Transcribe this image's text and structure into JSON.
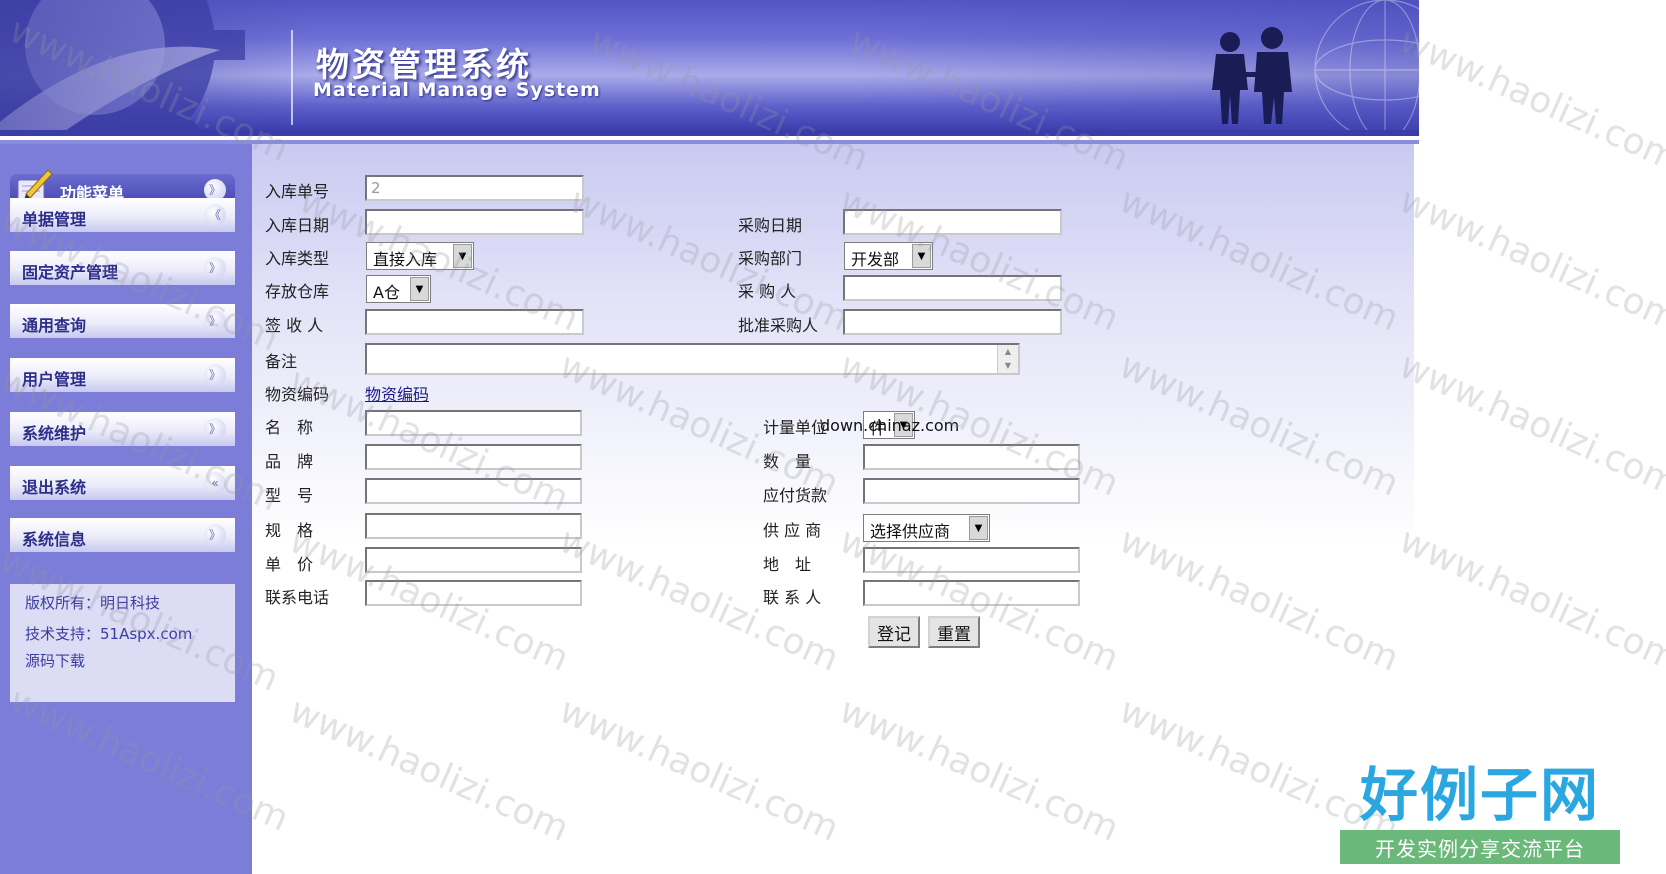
{
  "header": {
    "title": "物资管理系统",
    "subtitle": "Material Manage System"
  },
  "sidebar": {
    "menu_title": "功能菜单",
    "items": [
      {
        "label": "单据管理",
        "chevron": "up"
      },
      {
        "label": "固定资产管理",
        "chevron": "down"
      },
      {
        "label": "通用查询",
        "chevron": "down"
      },
      {
        "label": "用户管理",
        "chevron": "down"
      },
      {
        "label": "系统维护",
        "chevron": "down"
      },
      {
        "label": "退出系统",
        "chevron": "left"
      }
    ],
    "sysinfo": {
      "title": "系统信息",
      "copyright": "版权所有：明日科技",
      "support": "技术支持：51Aspx.com",
      "download": "源码下载"
    }
  },
  "form": {
    "labels": {
      "inbound_no": "入库单号",
      "inbound_date": "入库日期",
      "purchase_date": "采购日期",
      "inbound_type": "入库类型",
      "purchase_dept": "采购部门",
      "warehouse": "存放仓库",
      "buyer": "采 购 人",
      "receiver": "签 收 人",
      "approver": "批准采购人",
      "remark": "备注",
      "material_code": "物资编码",
      "name": "名　称",
      "brand": "品　牌",
      "model": "型　号",
      "spec": "规　格",
      "unit_price": "单　价",
      "phone": "联系电话",
      "unit": "计量单位",
      "quantity": "数　量",
      "payable": "应付货款",
      "supplier": "供 应 商",
      "address": "地　址",
      "contact": "联 系 人"
    },
    "values": {
      "inbound_no": "2",
      "inbound_type": "直接入库",
      "purchase_dept": "开发部",
      "warehouse": "A仓",
      "unit": "件",
      "supplier": "选择供应商"
    },
    "material_code_link": "物资编码",
    "unit_overlay": "down.chinaz.com",
    "buttons": {
      "submit": "登记",
      "reset": "重置"
    }
  },
  "watermark": "www.haolizi.com",
  "brand": {
    "name": "好例子网",
    "slogan": "开发实例分享交流平台"
  },
  "colors": {
    "sidebar_bg": "#7b7dd8",
    "header_bg": "#5355c4",
    "nav_text": "#2c2e8a",
    "brand_blue": "#2aa7e0",
    "brand_green": "#6bb97a"
  }
}
